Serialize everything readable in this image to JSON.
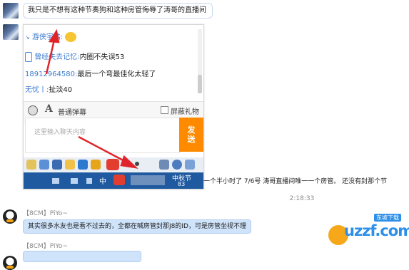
{
  "messages": [
    {
      "text": "我只是不想有这种节奏狗和这种房管侮辱了涛哥的直播间"
    }
  ],
  "shot": {
    "lines": [
      {
        "name": "游侠宇浩:",
        "text": ""
      },
      {
        "name": "曾经失去记忆:",
        "text": "内圈不失误53"
      },
      {
        "name": "18912964580:",
        "text": "最后一个弯最佳化太轻了"
      },
      {
        "name": "无忧丨:",
        "text": "扯淡40"
      }
    ],
    "danmu_label": "普通弹幕",
    "block_gift_label": "屏蔽礼物",
    "input_placeholder": "这里输入聊天内容",
    "send_label": "发送",
    "taskbar_tray": "中",
    "taskbar_date": "中秋节",
    "taskbar_num": "83"
  },
  "side_text": "一个半小时了 7/6号 涛哥直播间唯一一个房管。  还没有封那个节",
  "timestamp": "2:18:33",
  "msg2": {
    "sender": "【8CM】PiYo~",
    "text": "其实很多水友也是看不过去的，全都在喊房管封那J8的ID，可是房管坐视不理"
  },
  "msg3": {
    "sender": "【8CM】PiYo~"
  },
  "watermark": {
    "brand": "uzzf.com",
    "tag": "东坡下载"
  },
  "colors": {
    "accent": "#ff8a00",
    "bubble_blue": "#cfe3fb",
    "arrow": "#e0242a",
    "link": "#3b7bd0"
  }
}
